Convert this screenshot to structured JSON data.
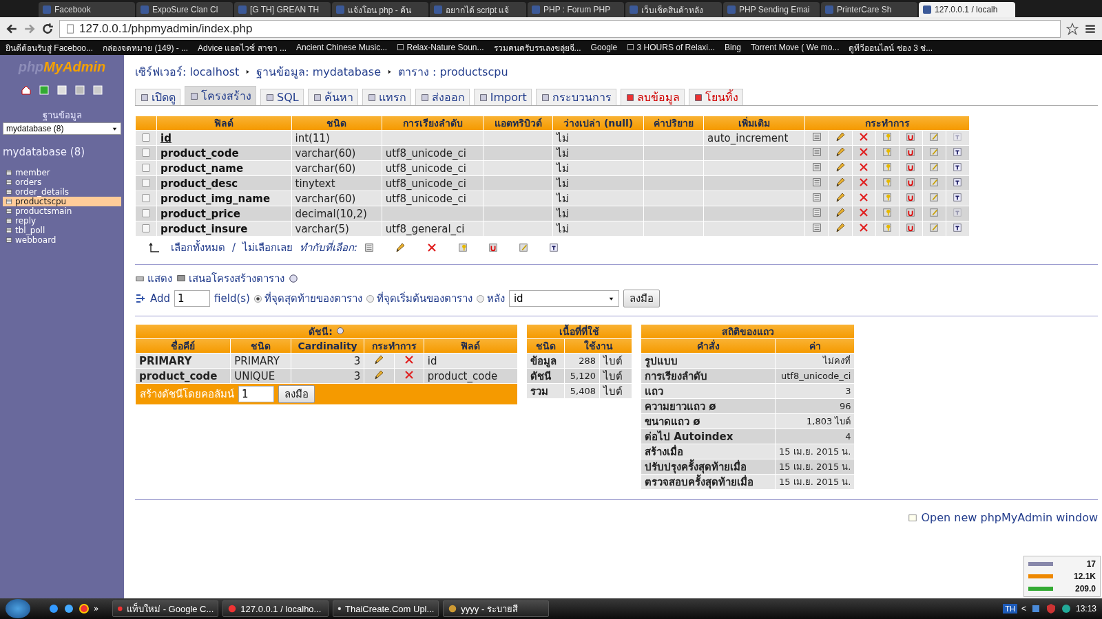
{
  "browser": {
    "tabs": [
      {
        "title": "Facebook",
        "selected": false
      },
      {
        "title": "ExpoSure Clan Cl",
        "selected": false
      },
      {
        "title": "[G TH] GREAN TH",
        "selected": false
      },
      {
        "title": "แจ้งโอน php - ค้น",
        "selected": false
      },
      {
        "title": "อยากได้ script แจ้",
        "selected": false
      },
      {
        "title": "PHP : Forum PHP",
        "selected": false
      },
      {
        "title": "เว็บเช็คสินค้าหลัง",
        "selected": false
      },
      {
        "title": "PHP Sending Emai",
        "selected": false
      },
      {
        "title": "PrinterCare Sh",
        "selected": false
      },
      {
        "title": "127.0.0.1 / localh",
        "selected": true
      }
    ],
    "address": "127.0.0.1/phpmyadmin/index.php",
    "bookmarks": [
      "ยินดีต้อนรับสู่ Faceboo...",
      "กล่องจดหมาย (149) - ...",
      "Advice แอดไวซ์ สาขา ...",
      "Ancient Chinese Music...",
      "☐ Relax-Nature Soun...",
      "รวมคนครับรรเลงขลุ่ยจี...",
      "Google",
      "☐ 3 HOURS of Relaxi...",
      "Bing",
      "Torrent Move ( We mo...",
      "ดูทีวีออนไลน์ ช่อง 3 ช่..."
    ]
  },
  "sidebar": {
    "logo": [
      "php",
      "MyAdmin"
    ],
    "database_label": "ฐานข้อมูล",
    "database_select": "mydatabase (8)",
    "database_title": "mydatabase (8)",
    "tables": [
      {
        "name": "member",
        "selected": false
      },
      {
        "name": "orders",
        "selected": false
      },
      {
        "name": "order_details",
        "selected": false
      },
      {
        "name": "productscpu",
        "selected": true
      },
      {
        "name": "productsmain",
        "selected": false
      },
      {
        "name": "reply",
        "selected": false
      },
      {
        "name": "tbl_poll",
        "selected": false
      },
      {
        "name": "webboard",
        "selected": false
      }
    ]
  },
  "breadcrumb": [
    "เซิร์ฟเวอร์: localhost",
    "ฐานข้อมูล: mydatabase",
    "ตาราง : productscpu"
  ],
  "tabs": [
    {
      "label": "เปิดดู",
      "selected": false,
      "kind": "normal"
    },
    {
      "label": "โครงสร้าง",
      "selected": true,
      "kind": "normal"
    },
    {
      "label": "SQL",
      "selected": false,
      "kind": "normal"
    },
    {
      "label": "ค้นหา",
      "selected": false,
      "kind": "normal"
    },
    {
      "label": "แทรก",
      "selected": false,
      "kind": "normal"
    },
    {
      "label": "ส่งออก",
      "selected": false,
      "kind": "normal"
    },
    {
      "label": "Import",
      "selected": false,
      "kind": "normal"
    },
    {
      "label": "กระบวนการ",
      "selected": false,
      "kind": "normal"
    },
    {
      "label": "ลบข้อมูล",
      "selected": false,
      "kind": "danger"
    },
    {
      "label": "โยนทิ้ง",
      "selected": false,
      "kind": "danger"
    }
  ],
  "structure": {
    "columns": [
      "ฟิลด์",
      "ชนิด",
      "การเรียงลำดับ",
      "แอตทริบิวต์",
      "ว่างเปล่า (null)",
      "ค่าปริยาย",
      "เพิ่มเติม",
      "กระทำการ"
    ],
    "rows": [
      {
        "checked": false,
        "primary": true,
        "field": "id",
        "type": "int(11)",
        "null": "ไม่",
        "extra": "auto_increment",
        "fulltext": false
      },
      {
        "checked": false,
        "primary": false,
        "field": "product_code",
        "type": "varchar(60)",
        "collation": "utf8_unicode_ci",
        "null": "ไม่",
        "fulltext": true
      },
      {
        "checked": false,
        "primary": false,
        "field": "product_name",
        "type": "varchar(60)",
        "collation": "utf8_unicode_ci",
        "null": "ไม่",
        "fulltext": true
      },
      {
        "checked": false,
        "primary": false,
        "field": "product_desc",
        "type": "tinytext",
        "collation": "utf8_unicode_ci",
        "null": "ไม่",
        "fulltext": true
      },
      {
        "checked": false,
        "primary": false,
        "field": "product_img_name",
        "type": "varchar(60)",
        "collation": "utf8_unicode_ci",
        "null": "ไม่",
        "fulltext": true
      },
      {
        "checked": false,
        "primary": false,
        "field": "product_price",
        "type": "decimal(10,2)",
        "null": "ไม่",
        "fulltext": false
      },
      {
        "checked": false,
        "primary": false,
        "field": "product_insure",
        "type": "varchar(5)",
        "collation": "utf8_general_ci",
        "null": "ไม่",
        "fulltext": true
      }
    ],
    "select_all": "เลือกทั้งหมด",
    "separator": "/",
    "select_none": "ไม่เลือกเลย",
    "with_selected": "ทำกับที่เลือก:"
  },
  "links": [
    "แสดง",
    "เสนอโครงสร้างตาราง"
  ],
  "add_fields": {
    "label": "Add",
    "value": "1",
    "unit": "field(s)",
    "options": [
      {
        "label": "ที่จุดสุดท้ายของตาราง",
        "selected": true
      },
      {
        "label": "ที่จุดเริ่มต้นของตาราง",
        "selected": false
      },
      {
        "label": "หลัง",
        "selected": false
      }
    ],
    "after": "id",
    "button": "ลงมือ"
  },
  "indexes": {
    "title": "ดัชนี:",
    "columns": [
      "ชื่อคีย์",
      "ชนิด",
      "Cardinality",
      "กระทำการ",
      "ฟิลด์"
    ],
    "rows": [
      {
        "key": "PRIMARY",
        "type": "PRIMARY",
        "cardinality": "3",
        "field": "id"
      },
      {
        "key": "product_code",
        "type": "UNIQUE",
        "cardinality": "3",
        "field": "product_code"
      }
    ],
    "create_label": "สร้างดัชนีโดยคอลัมน์",
    "create_value": "1",
    "button": "ลงมือ"
  },
  "space_usage": {
    "title": "เนื้อที่ที่ใช้",
    "columns": [
      "ชนิด",
      "ใช้งาน"
    ],
    "rows": [
      {
        "type": "ข้อมูล",
        "value": "288",
        "unit": "ไบต์"
      },
      {
        "type": "ดัชนี",
        "value": "5,120",
        "unit": "ไบต์"
      },
      {
        "type": "รวม",
        "value": "5,408",
        "unit": "ไบต์"
      }
    ]
  },
  "row_stats": {
    "title": "สถิติของแถว",
    "columns": [
      "คำสั่ง",
      "ค่า"
    ],
    "rows": [
      {
        "label": "รูปแบบ",
        "value": "ไม่คงที่"
      },
      {
        "label": "การเรียงลำดับ",
        "value": "utf8_unicode_ci"
      },
      {
        "label": "แถว",
        "value": "3"
      },
      {
        "label": "ความยาวแถว ø",
        "value": "96"
      },
      {
        "label": "ขนาดแถว ø",
        "value": "1,803 ไบต์"
      },
      {
        "label": "ต่อไป Autoindex",
        "value": "4"
      },
      {
        "label": "สร้างเมื่อ",
        "value": "15 เม.ย. 2015 น."
      },
      {
        "label": "ปรับปรุงครั้งสุดท้ายเมื่อ",
        "value": "15 เม.ย. 2015 น."
      },
      {
        "label": "ตรวจสอบครั้งสุดท้ายเมื่อ",
        "value": "15 เม.ย. 2015 น."
      }
    ]
  },
  "open_window": "Open new phpMyAdmin window",
  "monitor": [
    "17",
    "12.1K",
    "209.0"
  ],
  "taskbar": {
    "quick_more": "»",
    "items": [
      "แท็บใหม่ - Google C...",
      "127.0.0.1 / localho...",
      "ThaiCreate.Com Upl...",
      "yyyy - ระบายสี"
    ],
    "language": "TH",
    "tray_arrow": "<",
    "time": "13:13"
  }
}
